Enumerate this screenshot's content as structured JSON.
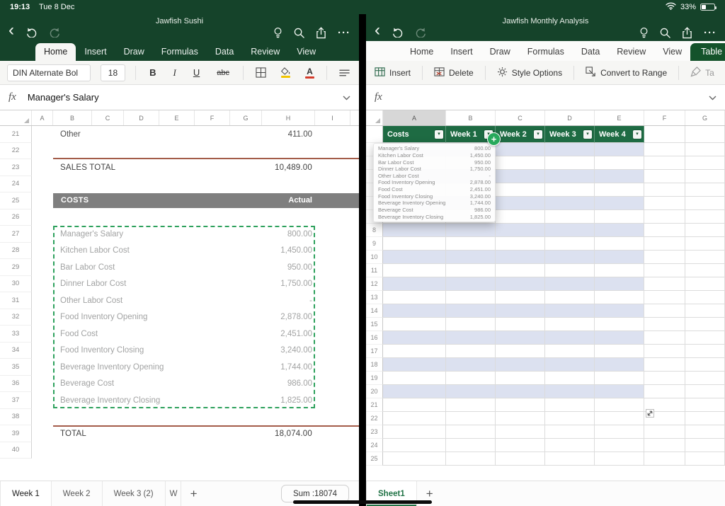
{
  "status_bar": {
    "time": "19:13",
    "date": "Tue 8 Dec",
    "battery_pct": "33%"
  },
  "icons": {
    "chevron_down": "▾",
    "back": "‹",
    "ellipsis": "···",
    "plus": "+"
  },
  "colors": {
    "chrome_green": "#15432A",
    "table_header_green": "#1E6B43",
    "active_tab_green": "#14532B",
    "accent_green": "#217346",
    "marquee_green": "#2EA15D",
    "plus_badge_green": "#27A95C",
    "band_blue": "#DCE1F0",
    "section_gray": "#7F7F7F",
    "rule_brick": "#A35C49"
  },
  "left_app": {
    "title": "Jawfish Sushi",
    "ribbon_tabs": [
      "Home",
      "Insert",
      "Draw",
      "Formulas",
      "Data",
      "Review",
      "View"
    ],
    "active_tab": "Home",
    "toolbar": {
      "font_name": "DIN Alternate Bol",
      "font_size": "18",
      "bold": "B",
      "italic": "I",
      "underline": "U",
      "strikethrough": "abc"
    },
    "formula_bar": {
      "fx_label": "fx",
      "value": "Manager's Salary"
    },
    "column_letters": [
      "A",
      "B",
      "C",
      "D",
      "E",
      "F",
      "G",
      "H",
      "I"
    ],
    "grid": {
      "rows": [
        {
          "n": 21,
          "type": "item-dark",
          "label": "Other",
          "value": "411.00"
        },
        {
          "n": 22,
          "type": "blank",
          "line": "bottom"
        },
        {
          "n": 23,
          "type": "subtotal",
          "label": "SALES TOTAL",
          "value": "10,489.00"
        },
        {
          "n": 24,
          "type": "blank"
        },
        {
          "n": 25,
          "type": "section",
          "label": "COSTS",
          "value": "Actual"
        },
        {
          "n": 26,
          "type": "blank"
        },
        {
          "n": 27,
          "type": "item",
          "label": "Manager's Salary",
          "value": "800.00"
        },
        {
          "n": 28,
          "type": "item",
          "label": "Kitchen Labor Cost",
          "value": "1,450.00"
        },
        {
          "n": 29,
          "type": "item",
          "label": "Bar Labor Cost",
          "value": "950.00"
        },
        {
          "n": 30,
          "type": "item",
          "label": "Dinner Labor Cost",
          "value": "1,750.00"
        },
        {
          "n": 31,
          "type": "item",
          "label": "Other Labor Cost",
          "value": "-"
        },
        {
          "n": 32,
          "type": "item",
          "label": "Food Inventory Opening",
          "value": "2,878.00"
        },
        {
          "n": 33,
          "type": "item",
          "label": "Food Cost",
          "value": "2,451.00"
        },
        {
          "n": 34,
          "type": "item",
          "label": "Food Inventory Closing",
          "value": "3,240.00"
        },
        {
          "n": 35,
          "type": "item",
          "label": "Beverage Inventory Opening",
          "value": "1,744.00"
        },
        {
          "n": 36,
          "type": "item",
          "label": "Beverage Cost",
          "value": "986.00"
        },
        {
          "n": 37,
          "type": "item",
          "label": "Beverage Inventory Closing",
          "value": "1,825.00"
        },
        {
          "n": 38,
          "type": "blank"
        },
        {
          "n": 39,
          "type": "subtotal",
          "line": "top",
          "label": "TOTAL",
          "value": "18,074.00"
        },
        {
          "n": 40,
          "type": "blank"
        }
      ]
    },
    "sheet_tabs": [
      {
        "label": "Week 1",
        "active": true
      },
      {
        "label": "Week 2"
      },
      {
        "label": "Week 3 (2)"
      },
      {
        "label": "W",
        "truncated": true
      }
    ],
    "add_sheet": "+",
    "sum_chip": "Sum :18074"
  },
  "right_app": {
    "title": "Jawfish Monthly Analysis",
    "ribbon_tabs": [
      "Home",
      "Insert",
      "Draw",
      "Formulas",
      "Data",
      "Review",
      "View",
      "Table"
    ],
    "active_tab": "Table",
    "toolbar": {
      "items": [
        {
          "label": "Insert"
        },
        {
          "label": "Delete"
        },
        {
          "label": "Style Options"
        },
        {
          "label": "Convert to Range"
        },
        {
          "label": "Ta",
          "truncated": true
        }
      ]
    },
    "formula_bar": {
      "fx_label": "fx"
    },
    "column_letters": [
      "A",
      "B",
      "C",
      "D",
      "E",
      "F",
      "G"
    ],
    "table_headers": [
      "Costs",
      "Week 1",
      "Week 2",
      "Week 3",
      "Week 4"
    ],
    "visible_row_numbers": [
      8,
      9,
      10,
      11,
      12,
      13,
      14,
      15,
      16,
      17,
      18,
      19,
      20,
      21,
      22,
      23,
      24,
      25
    ],
    "drag_preview": {
      "items": [
        {
          "label": "Manager's Salary",
          "value": "800.00"
        },
        {
          "label": "Kitchen Labor Cost",
          "value": "1,450.00"
        },
        {
          "label": "Bar Labor Cost",
          "value": "950.00"
        },
        {
          "label": "Dinner Labor Cost",
          "value": "1,750.00"
        },
        {
          "label": "Other Labor Cost",
          "value": "-"
        },
        {
          "label": "Food Inventory Opening",
          "value": "2,878.00"
        },
        {
          "label": "Food Cost",
          "value": "2,451.00"
        },
        {
          "label": "Food Inventory Closing",
          "value": "3,240.00"
        },
        {
          "label": "Beverage Inventory Opening",
          "value": "1,744.00"
        },
        {
          "label": "Beverage Cost",
          "value": "986.00"
        },
        {
          "label": "Beverage Inventory Closing",
          "value": "1,825.00"
        }
      ]
    },
    "sheet_tabs": [
      {
        "label": "Sheet1",
        "active": true,
        "green": true
      }
    ],
    "add_sheet": "+"
  }
}
